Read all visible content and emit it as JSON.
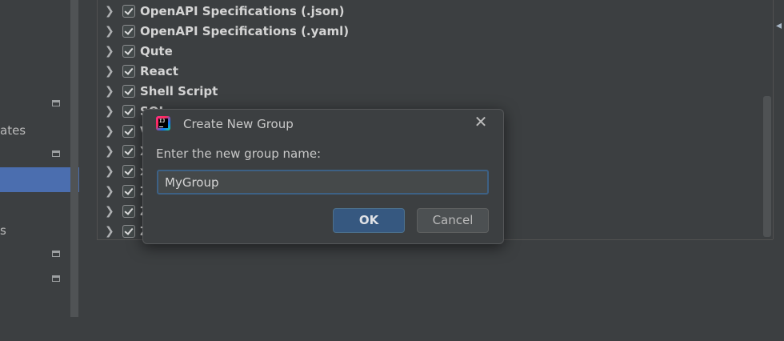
{
  "sidebar": {
    "partial_labels": [
      "ates",
      "s"
    ]
  },
  "tree": {
    "items": [
      {
        "label": "OpenAPI Specifications (.json)"
      },
      {
        "label": "OpenAPI Specifications (.yaml)"
      },
      {
        "label": "Qute"
      },
      {
        "label": "React"
      },
      {
        "label": "Shell Script"
      },
      {
        "label": "SQL"
      },
      {
        "label": "V"
      },
      {
        "label": "X"
      },
      {
        "label": "x"
      },
      {
        "label": "Z"
      },
      {
        "label": "Z"
      },
      {
        "label": "Z"
      }
    ]
  },
  "dialog": {
    "title": "Create New Group",
    "prompt": "Enter the new group name:",
    "input_value": "MyGroup",
    "ok_label": "OK",
    "cancel_label": "Cancel",
    "logo_text": "IJ"
  },
  "colors": {
    "background": "#3c3f41",
    "selection": "#4b6eaf",
    "primary_button": "#365880",
    "input_focus_border": "#3d6185"
  },
  "icons": [
    "chevron-right-icon",
    "checkbox-checked-icon",
    "intellij-logo-icon",
    "close-icon",
    "collapse-icon"
  ]
}
